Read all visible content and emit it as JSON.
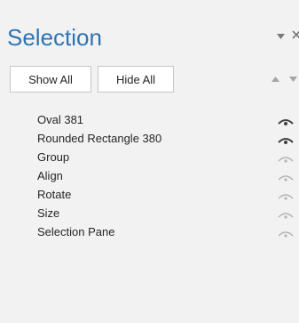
{
  "pane": {
    "title": "Selection",
    "show_all_label": "Show All",
    "hide_all_label": "Hide All"
  },
  "items": [
    {
      "label": "Oval 381",
      "visible": true
    },
    {
      "label": "Rounded Rectangle 380",
      "visible": true
    },
    {
      "label": "Group",
      "visible": false
    },
    {
      "label": "Align",
      "visible": false
    },
    {
      "label": "Rotate",
      "visible": false
    },
    {
      "label": "Size",
      "visible": false
    },
    {
      "label": "Selection Pane",
      "visible": false
    }
  ],
  "colors": {
    "title": "#2e74b5",
    "eye_visible": "#404040",
    "eye_hidden": "#b5b5b5",
    "arrow_disabled": "#a6a6a6",
    "pane_background": "#f2f2f2"
  },
  "icons": {
    "dropdown": "chevron-down-icon",
    "close": "close-icon",
    "move_up": "triangle-up-icon",
    "move_down": "triangle-down-icon",
    "visibility": "eye-icon"
  }
}
